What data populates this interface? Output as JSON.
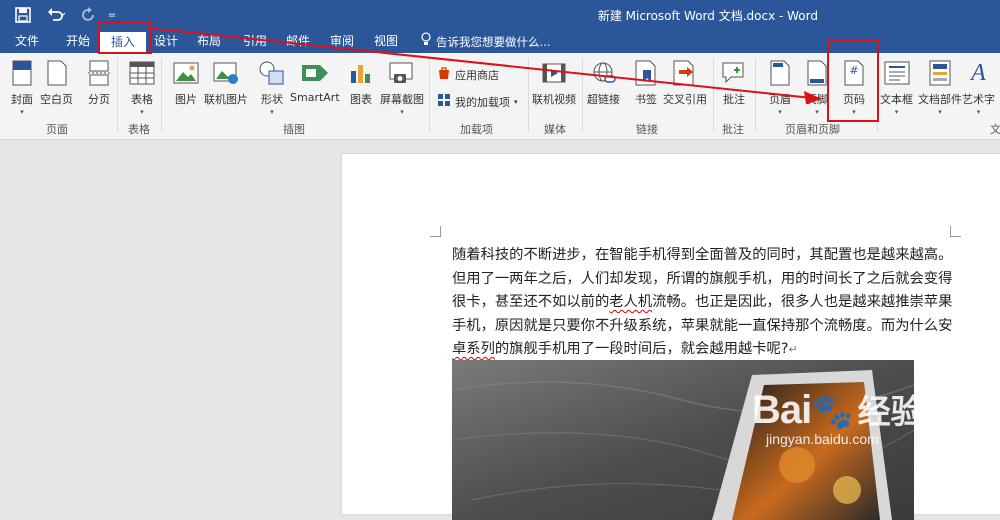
{
  "window": {
    "title": "新建 Microsoft Word 文档.docx - Word"
  },
  "quick_access": {
    "save_icon": "save-icon",
    "undo_icon": "undo-icon",
    "redo_icon": "redo-icon",
    "customize_glyph": "="
  },
  "tabs": [
    {
      "label": "文件"
    },
    {
      "label": "开始"
    },
    {
      "label": "插入"
    },
    {
      "label": "设计"
    },
    {
      "label": "布局"
    },
    {
      "label": "引用"
    },
    {
      "label": "邮件"
    },
    {
      "label": "审阅"
    },
    {
      "label": "视图"
    }
  ],
  "active_tab": "插入",
  "tell_me": {
    "text": "告诉我您想要做什么..."
  },
  "ribbon": {
    "buttons": {
      "cover": "封面",
      "blank_page": "空白页",
      "page_break": "分页",
      "table": "表格",
      "pictures": "图片",
      "online_pictures": "联机图片",
      "shapes": "形状",
      "smartart": "SmartArt",
      "chart": "图表",
      "screenshot": "屏幕截图",
      "store": "应用商店",
      "my_addins": "我的加载项",
      "online_video": "联机视频",
      "hyperlink": "超链接",
      "bookmark": "书签",
      "cross_reference": "交叉引用",
      "comment": "批注",
      "header": "页眉",
      "footer": "页脚",
      "page_number": "页码",
      "text_box": "文本框",
      "doc_parts": "文档部件",
      "wordart": "艺术字"
    },
    "groups": {
      "pages": "页面",
      "tables": "表格",
      "illustrations": "插图",
      "addins": "加载项",
      "media": "媒体",
      "links": "链接",
      "comments": "批注",
      "header_footer": "页眉和页脚",
      "text_partial": "文"
    },
    "page_number_glyph": "#"
  },
  "document": {
    "lines": [
      "随着科技的不断进步，在智能手机得到全面普及的同时，其配置也是越来越高。",
      "但用了一两年之后，人们却发现，所谓的旗舰手机，用的时间长了之后就会变得",
      "很卡，甚至还不如以前的",
      "老人机",
      "流畅。也正是因此，很多人也是越来越推崇苹果",
      "手机，原因就是只要你不升级系统，苹果就能一直保持那个流畅度。而为什么安",
      "卓系列",
      "的旗舰手机用了一段时间后，就会越用越卡呢?"
    ],
    "paragraph_mark": "↵"
  },
  "watermark": {
    "logo": "Bai",
    "logo_tail": "经验",
    "url": "jingyan.baidu.com"
  },
  "colors": {
    "accent": "#2b579a",
    "annotation": "#d9121a",
    "ribbon_bg": "#f4f4f4"
  }
}
